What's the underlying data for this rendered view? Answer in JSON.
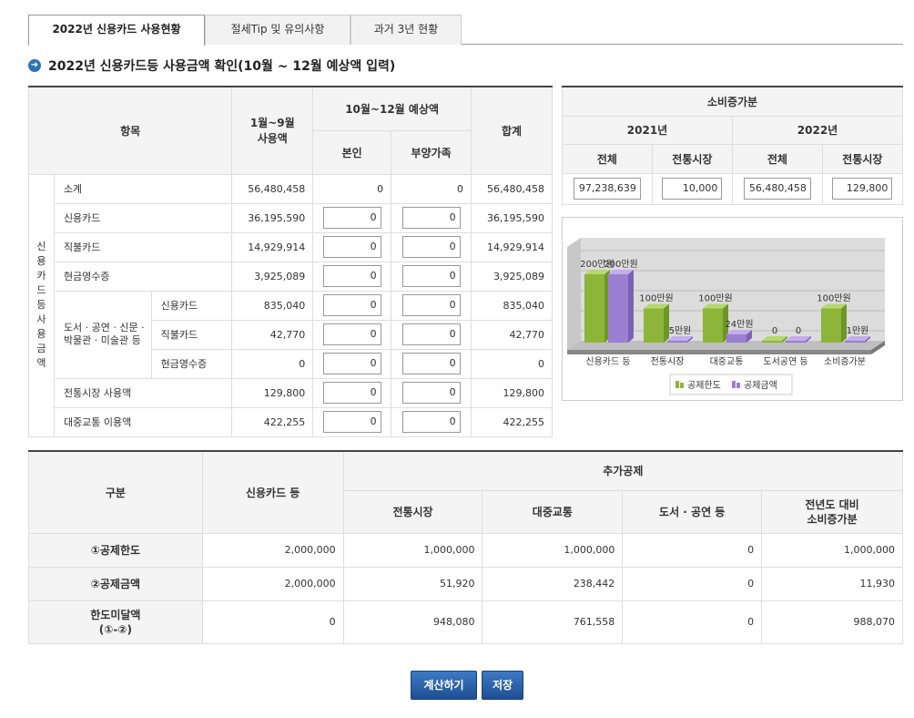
{
  "tabs": [
    {
      "label": "2022년 신용카드 사용현황"
    },
    {
      "label": "절세Tip 및 유의사항"
    },
    {
      "label": "과거 3년 현황"
    }
  ],
  "section_title": "2022년 신용카드등 사용금액 확인(10월 ~ 12월 예상액 입력)",
  "main_table": {
    "headers": {
      "item": "항목",
      "jan_sep": "1월~9월\n사용액",
      "oct_dec": "10월~12월 예상액",
      "self": "본인",
      "dependent": "부양가족",
      "total": "합계"
    },
    "vertical_label": "신용카드등 사용금액",
    "books_label": "도서 · 공연 · 신문 · 박물관 · 미술관 등",
    "rows": [
      {
        "label": "소계",
        "jan_sep": "56,480,458",
        "self": "0",
        "dependent": "0",
        "total": "56,480,458"
      },
      {
        "label": "신용카드",
        "jan_sep": "36,195,590",
        "self": "0",
        "dependent": "0",
        "total": "36,195,590"
      },
      {
        "label": "직불카드",
        "jan_sep": "14,929,914",
        "self": "0",
        "dependent": "0",
        "total": "14,929,914"
      },
      {
        "label": "현금영수증",
        "jan_sep": "3,925,089",
        "self": "0",
        "dependent": "0",
        "total": "3,925,089"
      },
      {
        "label": "신용카드",
        "jan_sep": "835,040",
        "self": "0",
        "dependent": "0",
        "total": "835,040"
      },
      {
        "label": "직불카드",
        "jan_sep": "42,770",
        "self": "0",
        "dependent": "0",
        "total": "42,770"
      },
      {
        "label": "현금영수증",
        "jan_sep": "0",
        "self": "0",
        "dependent": "0",
        "total": "0"
      },
      {
        "label": "전통시장 사용액",
        "jan_sep": "129,800",
        "self": "0",
        "dependent": "0",
        "total": "129,800"
      },
      {
        "label": "대중교통 이용액",
        "jan_sep": "422,255",
        "self": "0",
        "dependent": "0",
        "total": "422,255"
      }
    ]
  },
  "increase_table": {
    "title": "소비증가분",
    "year1": "2021년",
    "year2": "2022년",
    "col_total": "전체",
    "col_market": "전통시장",
    "values": {
      "y2021_total": "97,238,639",
      "y2021_market": "10,000",
      "y2022_total": "56,480,458",
      "y2022_market": "129,800"
    }
  },
  "chart_data": {
    "type": "bar",
    "categories": [
      "신용카드 등",
      "전통시장",
      "대중교통",
      "도서공연 등",
      "소비증가분"
    ],
    "series": [
      {
        "name": "공제한도",
        "values": [
          200,
          100,
          100,
          0,
          100
        ],
        "labels": [
          "200만원",
          "100만원",
          "100만원",
          "0",
          "100만원"
        ],
        "color": "#8db53a"
      },
      {
        "name": "공제금액",
        "values": [
          200,
          5,
          24,
          0,
          1
        ],
        "labels": [
          "200만원",
          "5만원",
          "24만원",
          "0",
          "1만원"
        ],
        "color": "#9b7fd0"
      }
    ]
  },
  "summary_table": {
    "headers": {
      "category": "구분",
      "credit": "신용카드 등",
      "additional": "추가공제",
      "market": "전통시장",
      "transit": "대중교통",
      "books": "도서 · 공연 등",
      "increase": "전년도 대비\n소비증가분"
    },
    "rows": [
      {
        "label": "①공제한도",
        "credit": "2,000,000",
        "market": "1,000,000",
        "transit": "1,000,000",
        "books": "0",
        "increase": "1,000,000"
      },
      {
        "label": "②공제금액",
        "credit": "2,000,000",
        "market": "51,920",
        "transit": "238,442",
        "books": "0",
        "increase": "11,930"
      },
      {
        "label": "한도미달액\n(①-②)",
        "credit": "0",
        "market": "948,080",
        "transit": "761,558",
        "books": "0",
        "increase": "988,070"
      }
    ]
  },
  "buttons": {
    "calculate": "계산하기",
    "save": "저장"
  },
  "colors": {
    "accent": "#2a74b8",
    "button": "#2b5fa8",
    "limit": "#8db53a",
    "amount": "#9b7fd0"
  }
}
